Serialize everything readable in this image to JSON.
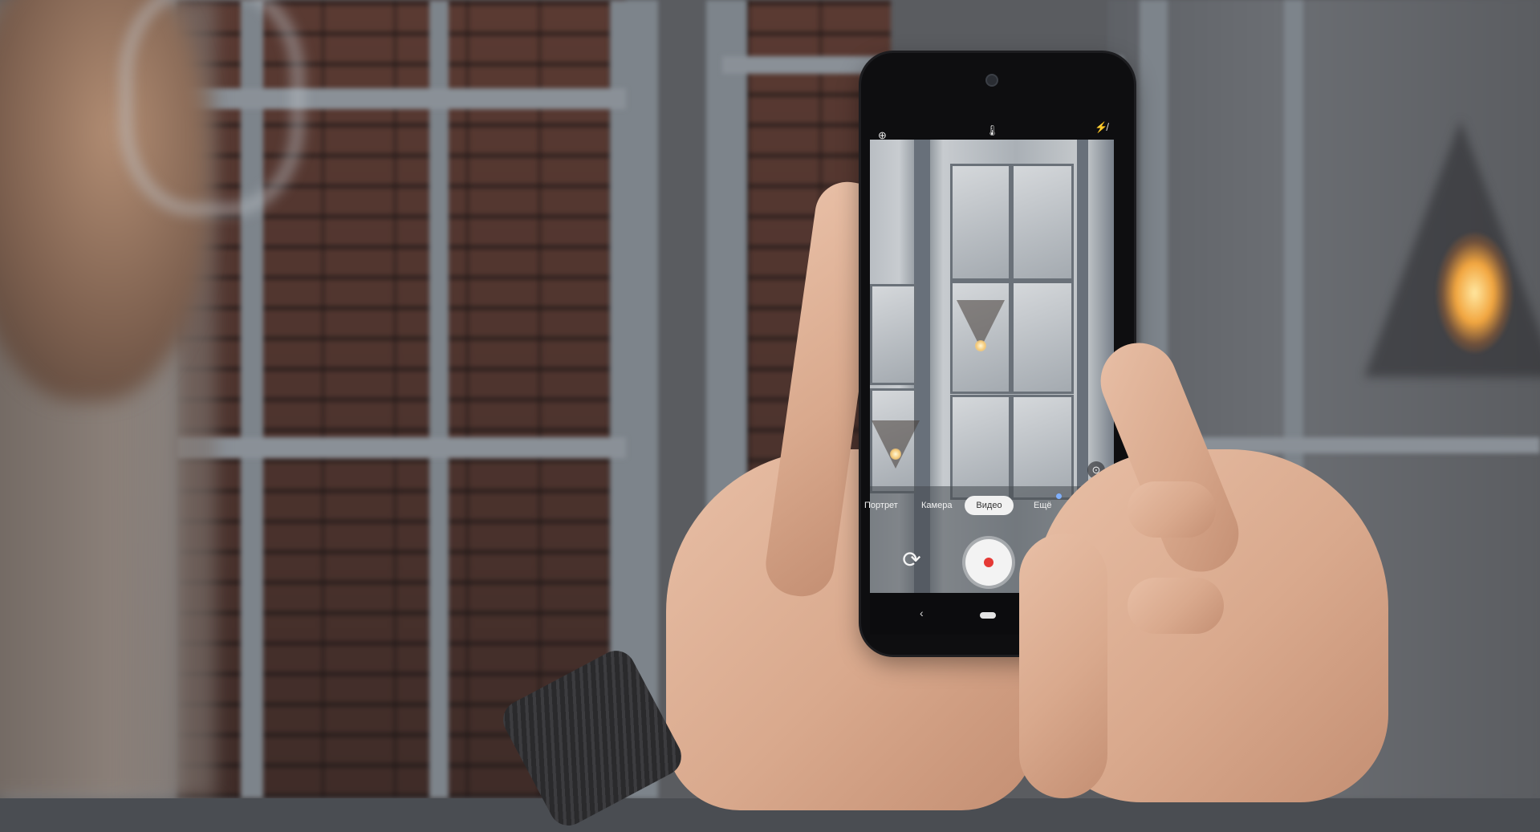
{
  "camera_app": {
    "status_icons": {
      "left": "hdr-auto-icon",
      "center": "temperature-icon",
      "right": "flash-off-icon"
    },
    "modes": [
      "Портрет",
      "Камера",
      "Видео",
      "Ещё"
    ],
    "active_mode": "Видео",
    "controls": {
      "switch_camera": "switch-camera-icon",
      "record": "record-button",
      "zoom": "zoom-icon"
    }
  },
  "colors": {
    "record_dot": "#e53935",
    "active_mode_bg": "#f1f1f1",
    "more_indicator": "#7fb0ff"
  }
}
